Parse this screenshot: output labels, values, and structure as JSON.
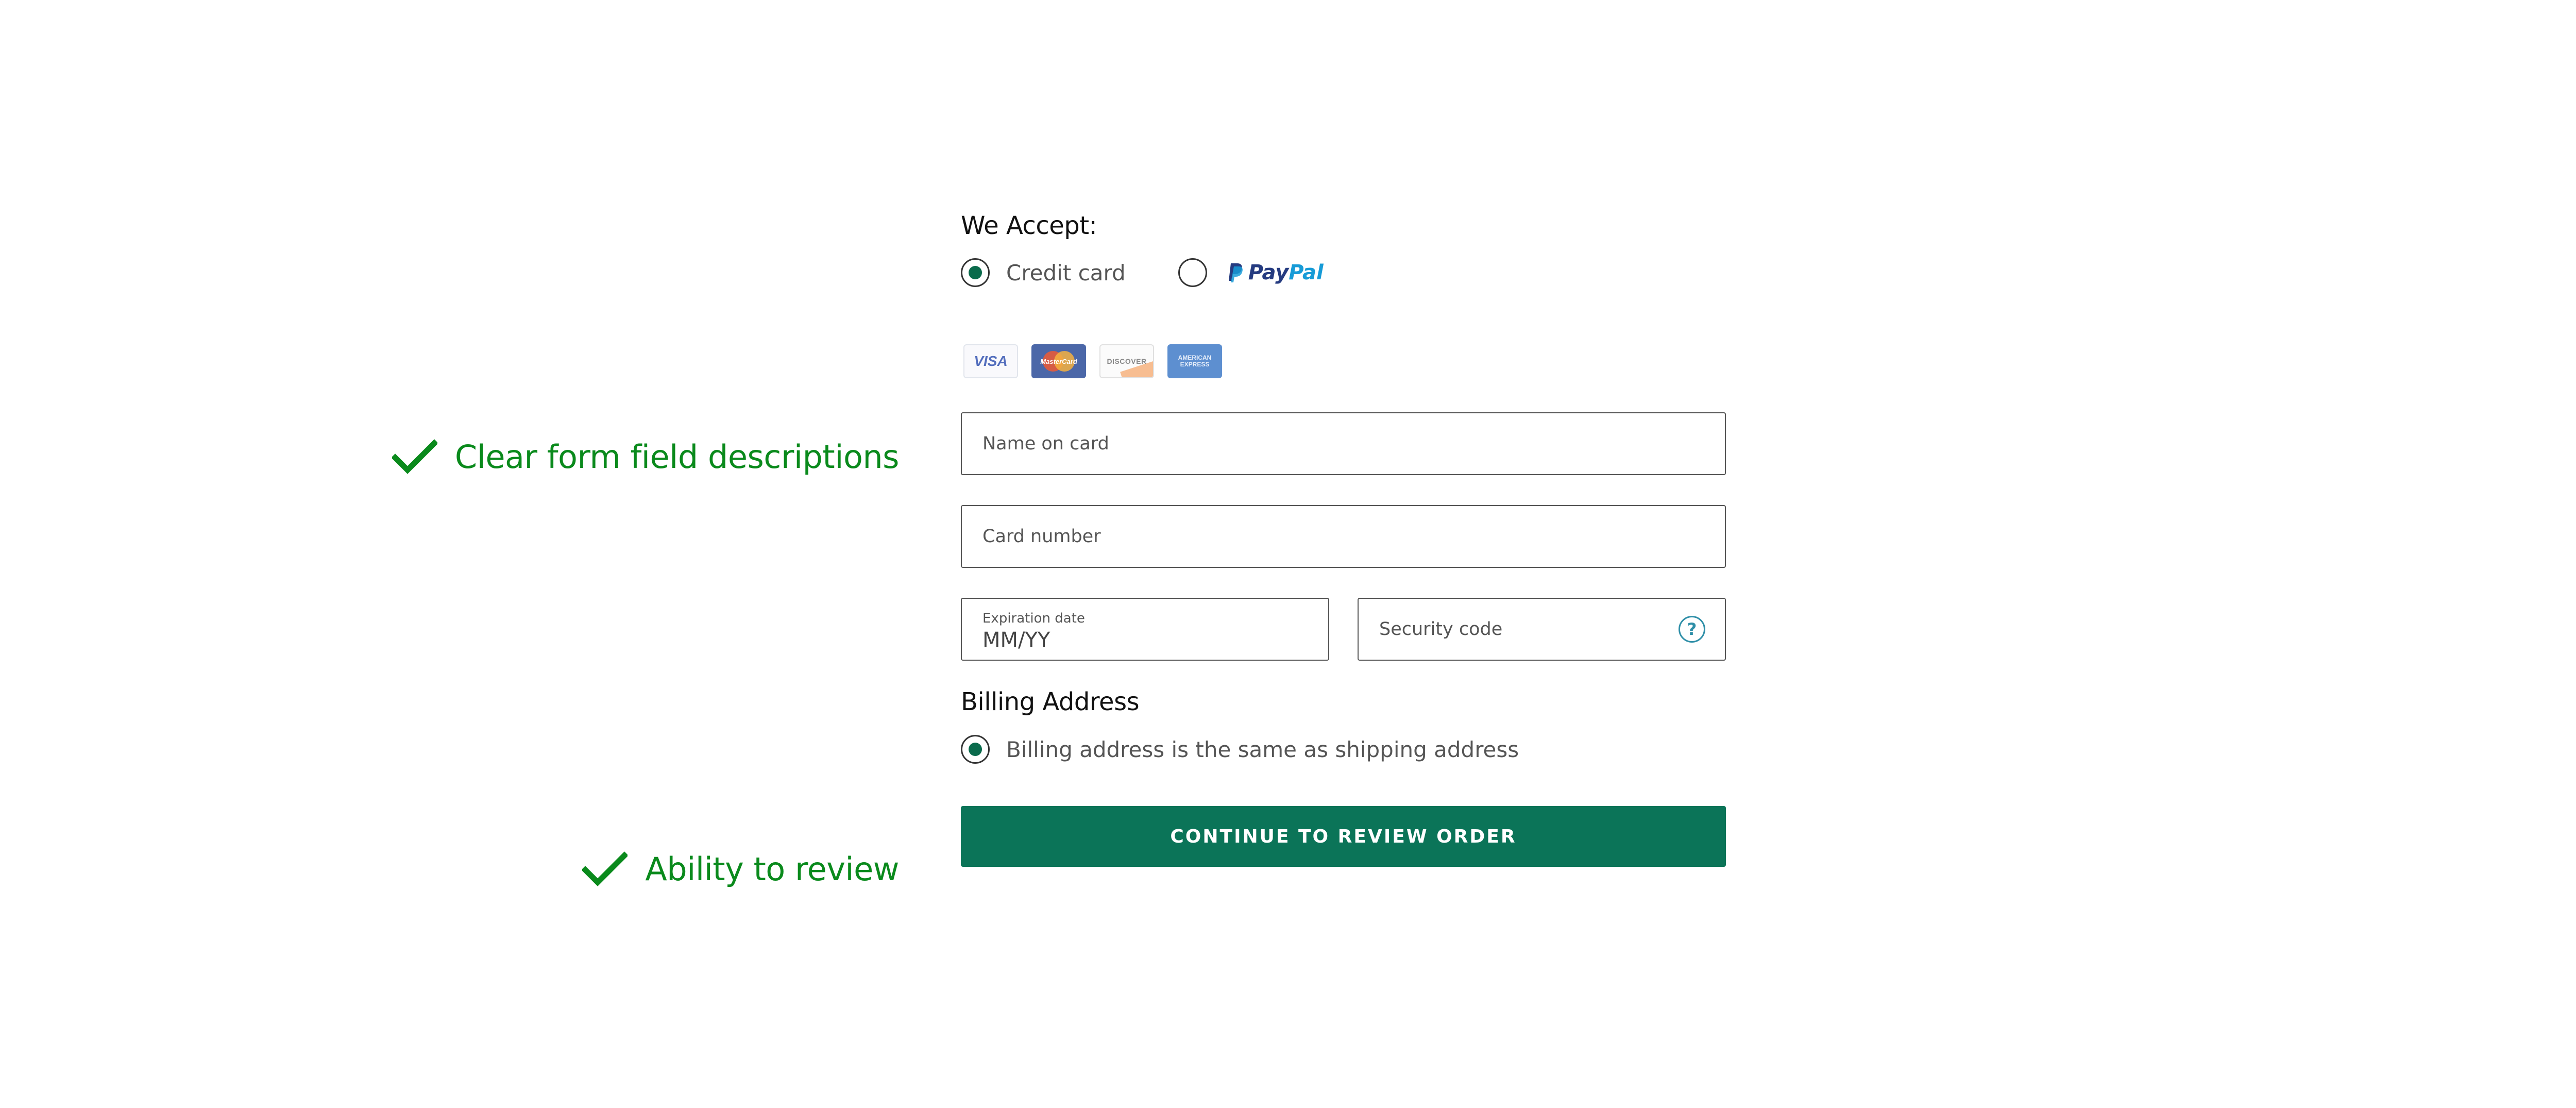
{
  "annotations": [
    {
      "text": "Clear form field descriptions"
    },
    {
      "text": "Ability to review"
    }
  ],
  "colors": {
    "annotation_green": "#0a8a1c",
    "primary_button": "#0b7458",
    "radio_selected": "#0a6b4c"
  },
  "payment": {
    "title": "We Accept:",
    "options": [
      {
        "label": "Credit card",
        "selected": true
      },
      {
        "label": "PayPal",
        "selected": false,
        "logo_text_1": "Pay",
        "logo_text_2": "Pal"
      }
    ],
    "card_logos": [
      {
        "name": "visa-logo",
        "text": "VISA"
      },
      {
        "name": "mastercard-logo",
        "text": "MasterCard"
      },
      {
        "name": "discover-logo",
        "text": "DISCOVER"
      },
      {
        "name": "amex-logo",
        "text_1": "AMERICAN",
        "text_2": "EXPRESS"
      }
    ]
  },
  "fields": {
    "name_on_card": {
      "placeholder": "Name on card"
    },
    "card_number": {
      "placeholder": "Card number"
    },
    "expiration": {
      "label": "Expiration date",
      "placeholder": "MM/YY"
    },
    "security_code": {
      "placeholder": "Security code",
      "help_icon": "?"
    }
  },
  "billing": {
    "title": "Billing Address",
    "same_as_shipping_label": "Billing address is the same as shipping address",
    "same_as_shipping_selected": true
  },
  "actions": {
    "continue_label": "CONTINUE TO REVIEW ORDER"
  }
}
